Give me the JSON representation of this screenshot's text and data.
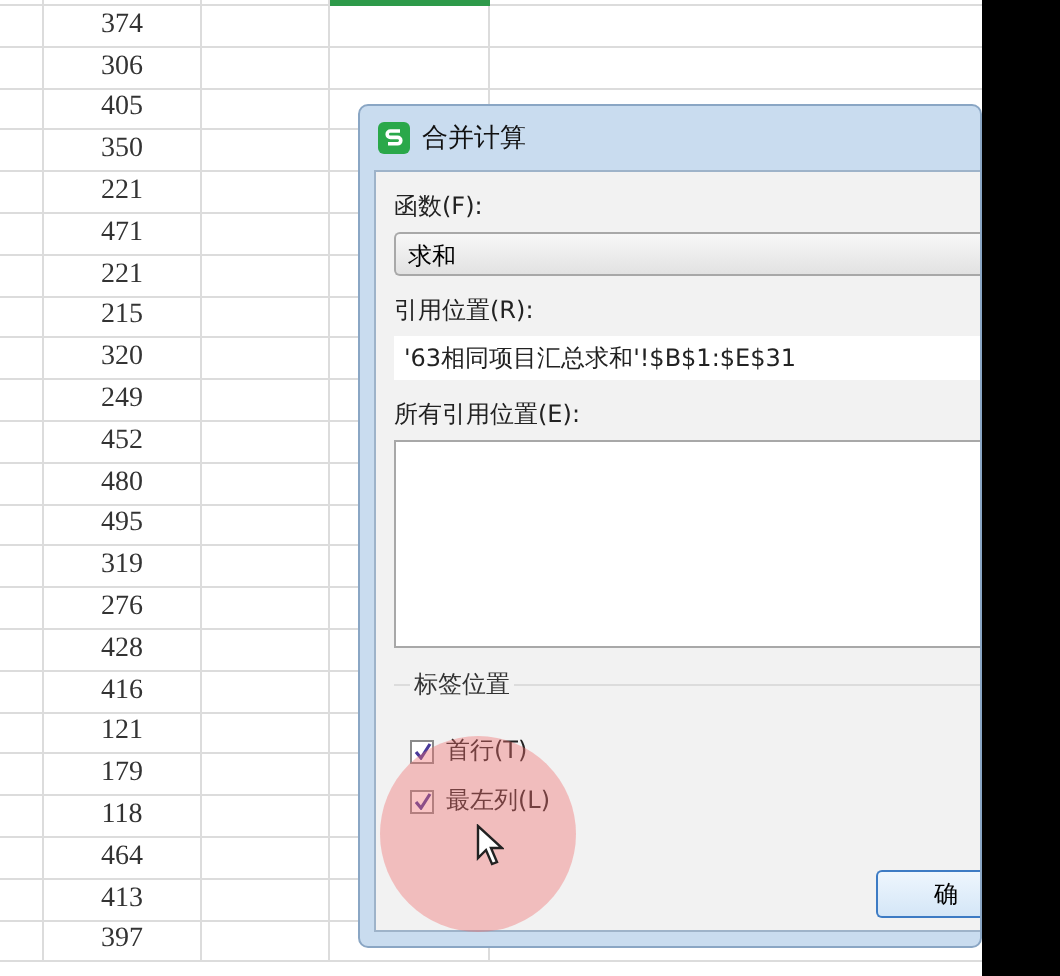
{
  "sheet": {
    "column_b": [
      "374",
      "306",
      "405",
      "350",
      "221",
      "471",
      "221",
      "215",
      "320",
      "249",
      "452",
      "480",
      "495",
      "319",
      "276",
      "428",
      "416",
      "121",
      "179",
      "118",
      "464",
      "413",
      "397"
    ]
  },
  "dialog": {
    "title": "合并计算",
    "function_label": "函数(F):",
    "function_value": "求和",
    "reference_label": "引用位置(R):",
    "reference_value": "'63相同项目汇总求和'!$B$1:$E$31",
    "all_references_label": "所有引用位置(E):",
    "label_group": "标签位置",
    "options": [
      {
        "label": "首行(T)",
        "checked": true
      },
      {
        "label": "最左列(L)",
        "checked": true
      }
    ],
    "ok_button": "确"
  }
}
